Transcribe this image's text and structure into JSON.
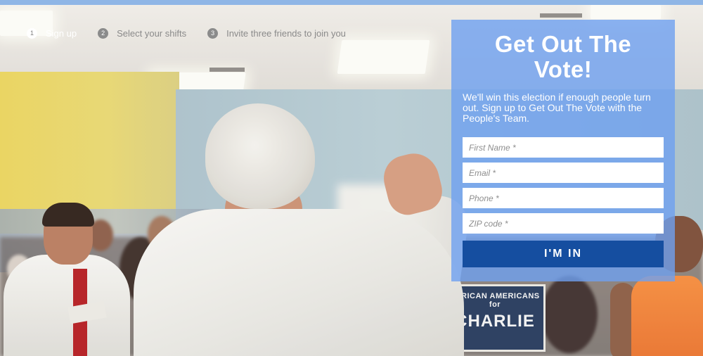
{
  "steps": [
    {
      "number": "1",
      "label": "Sign up",
      "active": true
    },
    {
      "number": "2",
      "label": "Select your shifts",
      "active": false
    },
    {
      "number": "3",
      "label": "Invite three friends to join you",
      "active": false
    }
  ],
  "signup": {
    "title": "Get Out The Vote!",
    "description": "We'll win this election if enough people turn out. Sign up to Get Out The Vote with the People's Team.",
    "fields": {
      "first_name": {
        "placeholder": "First Name *",
        "value": ""
      },
      "email": {
        "placeholder": "Email *",
        "value": ""
      },
      "phone": {
        "placeholder": "Phone *",
        "value": ""
      },
      "zip": {
        "placeholder": "ZIP code *",
        "value": ""
      }
    },
    "submit_label": "I'M IN"
  },
  "background": {
    "sign_small_text": "AFRICAN AMERICANS for",
    "sign_big_text": "CHARLIE"
  },
  "colors": {
    "top_bar": "#8fb6e6",
    "panel_bg": "#6ea0f0",
    "button_bg": "#154ea0",
    "text_on_panel": "#ffffff"
  }
}
